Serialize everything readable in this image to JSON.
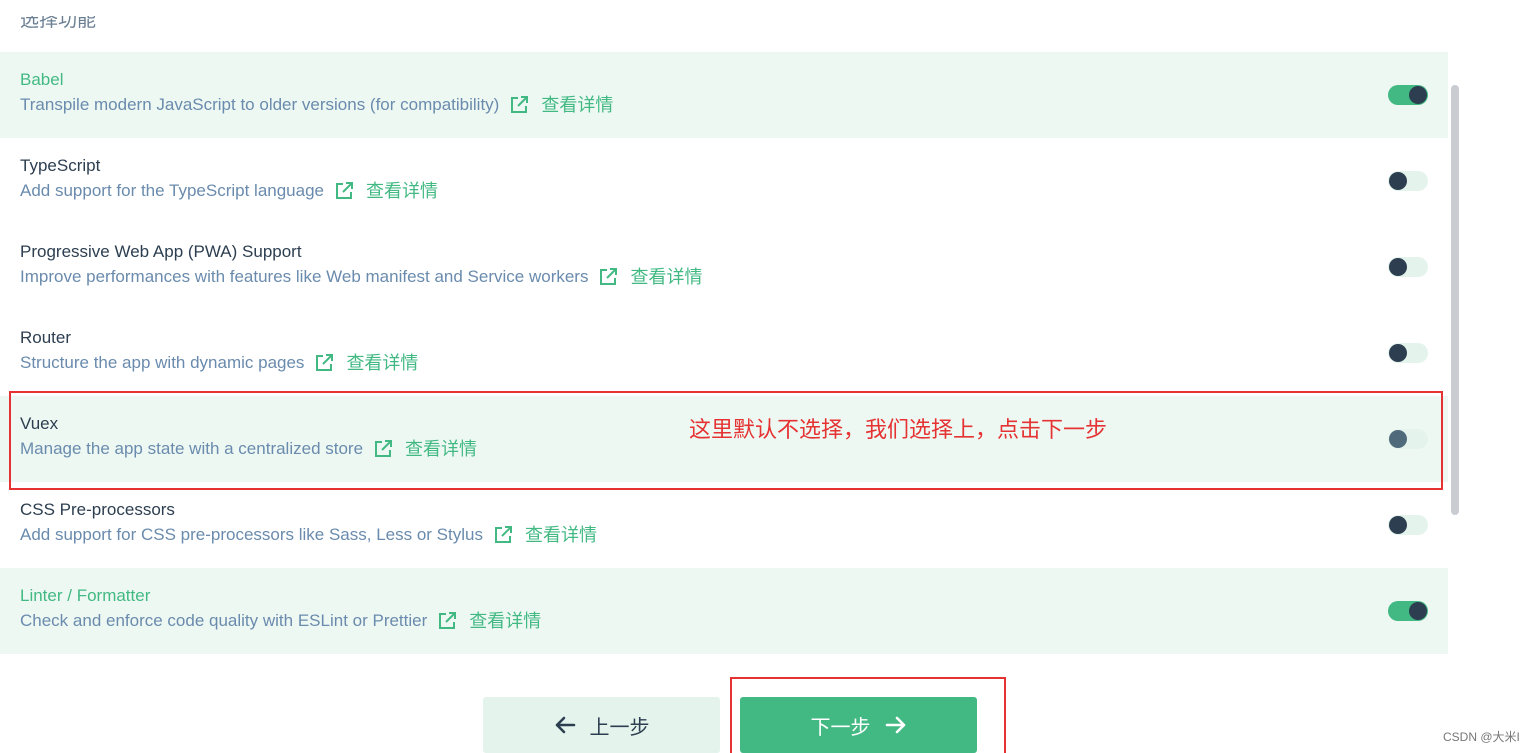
{
  "section": {
    "title": "选择功能"
  },
  "features": [
    {
      "name": "Babel",
      "description": "Transpile modern JavaScript to older versions (for compatibility)",
      "link": "查看详情",
      "enabled": true,
      "selected": true
    },
    {
      "name": "TypeScript",
      "description": "Add support for the TypeScript language",
      "link": "查看详情",
      "enabled": false,
      "selected": false
    },
    {
      "name": "Progressive Web App (PWA) Support",
      "description": "Improve performances with features like Web manifest and Service workers",
      "link": "查看详情",
      "enabled": false,
      "selected": false
    },
    {
      "name": "Router",
      "description": "Structure the app with dynamic pages",
      "link": "查看详情",
      "enabled": false,
      "selected": false
    },
    {
      "name": "Vuex",
      "description": "Manage the app state with a centralized store",
      "link": "查看详情",
      "enabled": false,
      "selected": true
    },
    {
      "name": "CSS Pre-processors",
      "description": "Add support for CSS pre-processors like Sass, Less or Stylus",
      "link": "查看详情",
      "enabled": false,
      "selected": false
    },
    {
      "name": "Linter / Formatter",
      "description": "Check and enforce code quality with ESLint or Prettier",
      "link": "查看详情",
      "enabled": true,
      "selected": true
    }
  ],
  "annotation": {
    "text": "这里默认不选择，我们选择上，点击下一步"
  },
  "buttons": {
    "prev_label": "上一步",
    "next_label": "下一步"
  },
  "watermark": "CSDN @大米I",
  "colors": {
    "accent": "#42b983",
    "text": "#2c3e50",
    "muted": "#6a8bad",
    "annotation": "#e53333"
  }
}
